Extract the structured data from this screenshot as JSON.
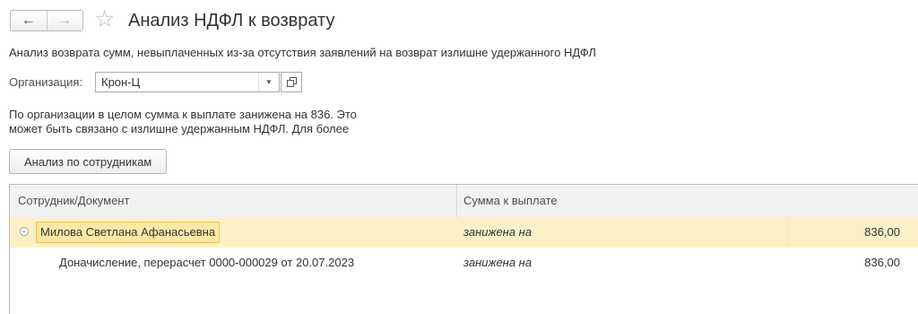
{
  "toolbar": {
    "back_icon": "arrow-left-icon",
    "forward_icon": "arrow-right-icon",
    "favorite_icon": "star-icon"
  },
  "page": {
    "title": "Анализ НДФЛ к возврату",
    "description": "Анализ возврата сумм, невыплаченных из-за отсутствия заявлений на возврат излишне удержанного НДФЛ"
  },
  "organization": {
    "label": "Организация:",
    "value": "Крон-Ц"
  },
  "notice": {
    "line1": "По организации в целом сумма к выплате занижена на 836. Это",
    "line2": "может быть связано с излишне удержанным НДФЛ. Для более"
  },
  "analyze_button": "Анализ по сотрудникам",
  "table": {
    "columns": [
      "Сотрудник/Документ",
      "Сумма к выплате"
    ],
    "rows": [
      {
        "name": "Милова Светлана Афанасьевна",
        "status": "занижена на",
        "amount": "836,00",
        "expanded": true,
        "selected": true
      },
      {
        "name": "Доначисление, перерасчет 0000-000029 от 20.07.2023",
        "status": "занижена на",
        "amount": "836,00"
      }
    ]
  },
  "colors": {
    "selected_row": "#fbf0c6",
    "selected_cell": "#fde8a8",
    "selected_border": "#f2c14e"
  }
}
